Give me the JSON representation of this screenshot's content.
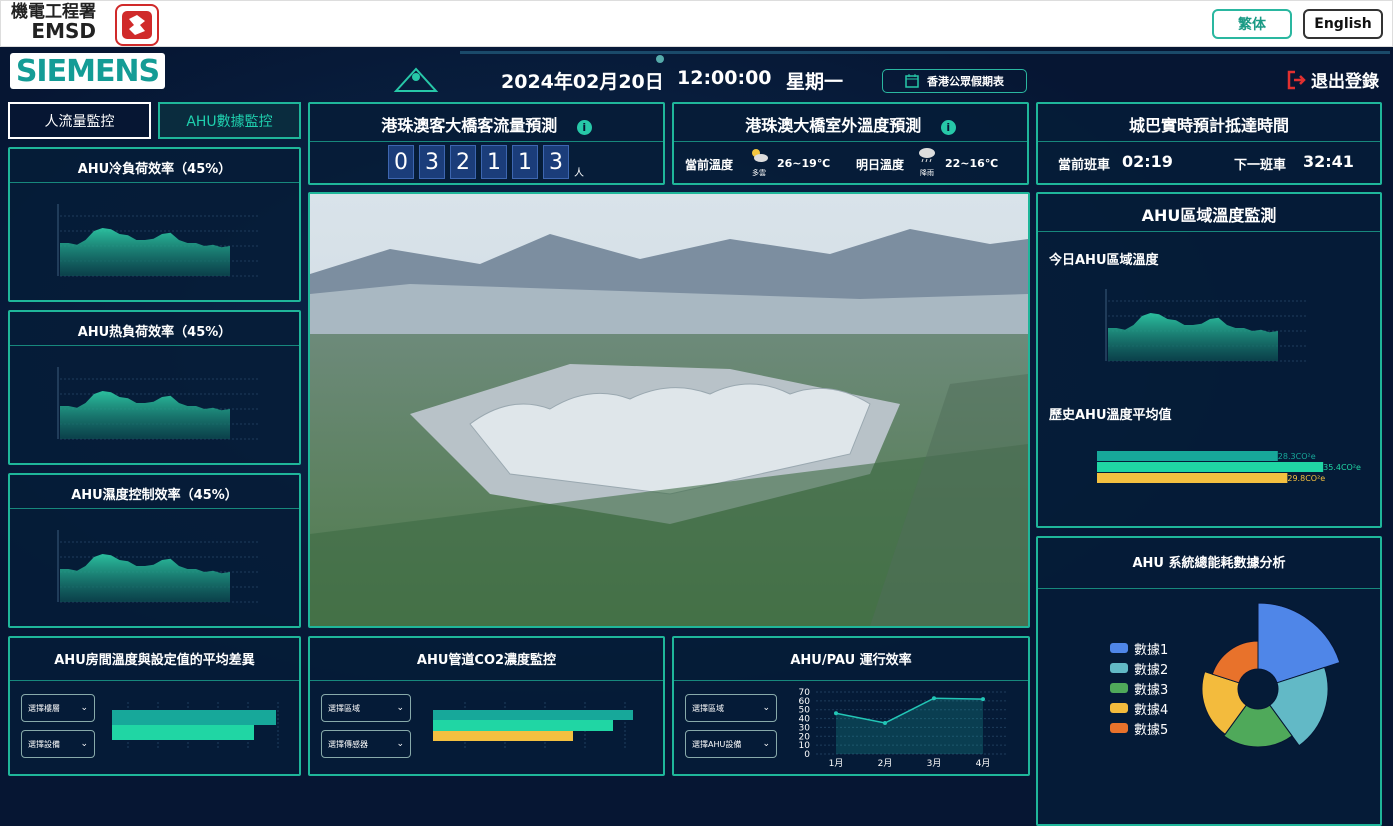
{
  "header": {
    "logo_cn": "機電工程署",
    "logo_en": "EMSD",
    "btn_trad": "繁体",
    "btn_eng": "English"
  },
  "bar": {
    "brand": "SIEMENS",
    "date": "2024年02月20日",
    "time": "12:00:00",
    "weekday": "星期一",
    "holiday": "香港公眾假期表",
    "logout": "退出登錄"
  },
  "tabs": {
    "flow": "人流量監控",
    "ahu": "AHU數據監控"
  },
  "left": {
    "cold": {
      "title": "AHU冷負荷效率（45%）"
    },
    "heat": {
      "title": "AHU热負荷效率（45%）"
    },
    "humid": {
      "title": "AHU濕度控制效率（45%）"
    }
  },
  "passenger": {
    "title": "港珠澳客大橋客流量預測",
    "digits": [
      "0",
      "3",
      "2",
      "1",
      "1",
      "3"
    ],
    "unit": "人"
  },
  "weather": {
    "title": "港珠澳大橋室外溫度預測",
    "today_label": "當前溫度",
    "today_cond": "多雲",
    "today_range": "26~19℃",
    "tomorrow_label": "明日溫度",
    "tomorrow_cond": "降雨",
    "tomorrow_range": "22~16℃"
  },
  "bus": {
    "title": "城巴實時預計抵達時間",
    "cur_label": "當前班車",
    "cur_time": "02:19",
    "next_label": "下一班車",
    "next_time": "32:41"
  },
  "zone": {
    "title": "AHU區域溫度監測",
    "today_title": "今日AHU區域溫度",
    "hist_title": "歷史AHU溫度平均值",
    "bars": [
      {
        "label": "28.3CO²e",
        "value": 28.3,
        "color": "#17a89a"
      },
      {
        "label": "35.4CO²e",
        "value": 35.4,
        "color": "#20d6a4"
      },
      {
        "label": "29.8CO²e",
        "value": 29.8,
        "color": "#f4c040"
      }
    ]
  },
  "energy": {
    "title": "AHU 系統總能耗數據分析",
    "items": [
      {
        "name": "數據1",
        "color": "#4f86e8"
      },
      {
        "name": "數據2",
        "color": "#62b9c6"
      },
      {
        "name": "數據3",
        "color": "#4fa95a"
      },
      {
        "name": "數據4",
        "color": "#f3bb3d"
      },
      {
        "name": "數據5",
        "color": "#e8722b"
      }
    ]
  },
  "diff": {
    "title": "AHU房間溫度與設定值的平均差異",
    "sel1": "選擇樓層",
    "sel2": "選擇設備"
  },
  "co2": {
    "title": "AHU管道CO2濃度監控",
    "sel1": "選擇區域",
    "sel2": "選擇傳感器"
  },
  "pau": {
    "title": "AHU/PAU 運行效率",
    "sel1": "選擇區域",
    "sel2": "選擇AHU設備"
  },
  "chart_data": [
    {
      "type": "line",
      "title": "AHU/PAU 運行效率",
      "categories": [
        "1月",
        "2月",
        "3月",
        "4月"
      ],
      "values": [
        46,
        35,
        63,
        62
      ],
      "ylim": [
        0,
        70
      ],
      "yticks": [
        0,
        10,
        20,
        30,
        40,
        50,
        60,
        70
      ]
    }
  ]
}
